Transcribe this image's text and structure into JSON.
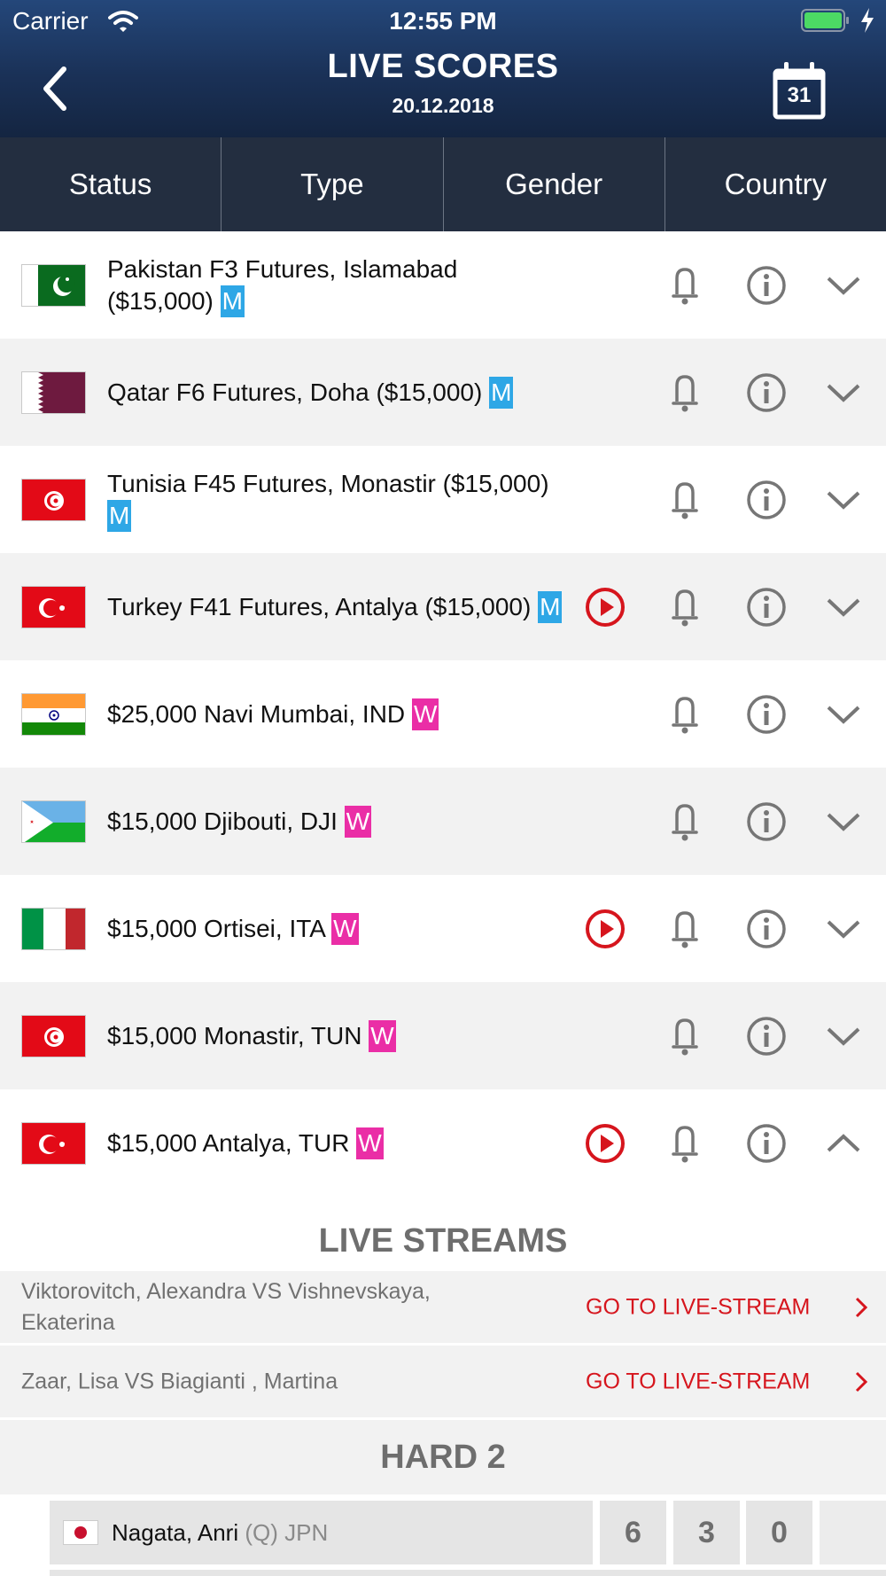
{
  "status_bar": {
    "carrier": "Carrier",
    "time": "12:55 PM",
    "battery_color": "#4cd964"
  },
  "header": {
    "title": "LIVE SCORES",
    "date": "20.12.2018",
    "calendar_day": "31",
    "back_icon": "chevron-left-icon",
    "calendar_icon": "calendar-icon"
  },
  "filters": [
    {
      "label": "Status"
    },
    {
      "label": "Type"
    },
    {
      "label": "Gender"
    },
    {
      "label": "Country"
    }
  ],
  "colors": {
    "men_badge": "#2ea7e6",
    "women_badge": "#ea2ea6",
    "live_red": "#d6151d",
    "header_dark": "#142541",
    "filter_bar": "#232e40"
  },
  "tournaments": [
    {
      "name": "Pakistan F3 Futures, Islamabad ($15,000)",
      "gender": "M",
      "country_flag": "PAK",
      "live": false,
      "expanded": false
    },
    {
      "name": "Qatar F6 Futures, Doha ($15,000)",
      "gender": "M",
      "country_flag": "QAT",
      "live": false,
      "expanded": false
    },
    {
      "name": "Tunisia F45 Futures, Monastir ($15,000)",
      "gender": "M",
      "country_flag": "TUN",
      "live": false,
      "expanded": false
    },
    {
      "name": "Turkey F41 Futures, Antalya ($15,000)",
      "gender": "M",
      "country_flag": "TUR",
      "live": true,
      "expanded": false
    },
    {
      "name": "$25,000 Navi Mumbai, IND",
      "gender": "W",
      "country_flag": "IND",
      "live": false,
      "expanded": false
    },
    {
      "name": "$15,000 Djibouti, DJI",
      "gender": "W",
      "country_flag": "DJI",
      "live": false,
      "expanded": false
    },
    {
      "name": "$15,000 Ortisei, ITA",
      "gender": "W",
      "country_flag": "ITA",
      "live": true,
      "expanded": false
    },
    {
      "name": "$15,000 Monastir, TUN",
      "gender": "W",
      "country_flag": "TUN",
      "live": false,
      "expanded": false
    },
    {
      "name": "$15,000 Antalya, TUR",
      "gender": "W",
      "country_flag": "TUR",
      "live": true,
      "expanded": true
    }
  ],
  "live_streams": {
    "title": "LIVE STREAMS",
    "items": [
      {
        "players": "Viktorovitch, Alexandra VS Vishnevskaya, Ekaterina",
        "link": "GO TO LIVE-STREAM"
      },
      {
        "players": "Zaar, Lisa VS Biagianti , Martina",
        "link": "GO TO LIVE-STREAM"
      }
    ]
  },
  "court": {
    "title": "HARD 2",
    "matches": [
      {
        "player": "Nagata, Anri",
        "seed": "(Q)",
        "country": "JPN",
        "flag": "JPN",
        "scores": [
          "6",
          "3",
          "0",
          ""
        ]
      }
    ]
  }
}
